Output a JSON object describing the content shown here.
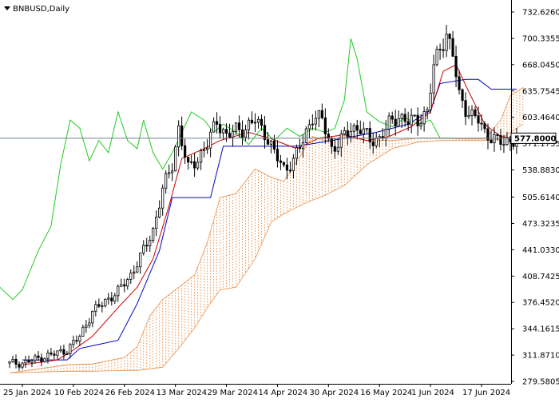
{
  "chart_data": {
    "type": "candlestick-ichimoku",
    "title": "BNBUSD,Daily",
    "current_price": {
      "label": "577.8000",
      "value": 577.8
    },
    "y_ticks": [
      {
        "label": "732.6260",
        "value": 732.626
      },
      {
        "label": "700.3355",
        "value": 700.3355
      },
      {
        "label": "668.0450",
        "value": 668.045
      },
      {
        "label": "635.7545",
        "value": 635.7545
      },
      {
        "label": "603.4640",
        "value": 603.464
      },
      {
        "label": "571.1735",
        "value": 571.1735
      },
      {
        "label": "538.8830",
        "value": 538.883
      },
      {
        "label": "505.6140",
        "value": 505.614
      },
      {
        "label": "473.3235",
        "value": 473.3235
      },
      {
        "label": "441.0330",
        "value": 441.033
      },
      {
        "label": "408.7425",
        "value": 408.7425
      },
      {
        "label": "376.4520",
        "value": 376.452
      },
      {
        "label": "344.1615",
        "value": 344.1615
      },
      {
        "label": "311.8710",
        "value": 311.871
      },
      {
        "label": "279.5805",
        "value": 279.5805
      }
    ],
    "x_ticks": [
      {
        "label": "25 Jan 2024",
        "date": "2024-01-25"
      },
      {
        "label": "10 Feb 2024",
        "date": "2024-02-10"
      },
      {
        "label": "26 Feb 2024",
        "date": "2024-02-26"
      },
      {
        "label": "13 Mar 2024",
        "date": "2024-03-13"
      },
      {
        "label": "29 Mar 2024",
        "date": "2024-03-29"
      },
      {
        "label": "14 Apr 2024",
        "date": "2024-04-14"
      },
      {
        "label": "30 Apr 2024",
        "date": "2024-04-30"
      },
      {
        "label": "16 May 2024",
        "date": "2024-05-16"
      },
      {
        "label": "1 Jun 2024",
        "date": "2024-06-01"
      },
      {
        "label": "17 Jun 2024",
        "date": "2024-06-17"
      }
    ],
    "ylim": [
      279.5805,
      745
    ],
    "colors": {
      "candle": "#000000",
      "tenkan": "#cc0000",
      "kijun": "#0000cc",
      "chikou": "#22cc22",
      "cloud": "#e8904a",
      "price_line": "#708090",
      "price_box": "#ffffff"
    },
    "series": [
      {
        "key": "close",
        "points": [
          [
            "2024-01-25",
            302
          ],
          [
            "2024-02-01",
            310
          ],
          [
            "2024-02-08",
            318
          ],
          [
            "2024-02-12",
            335
          ],
          [
            "2024-02-16",
            365
          ],
          [
            "2024-02-20",
            378
          ],
          [
            "2024-02-24",
            390
          ],
          [
            "2024-02-28",
            410
          ],
          [
            "2024-03-03",
            440
          ],
          [
            "2024-03-06",
            465
          ],
          [
            "2024-03-09",
            515
          ],
          [
            "2024-03-12",
            545
          ],
          [
            "2024-03-14",
            590
          ],
          [
            "2024-03-17",
            540
          ],
          [
            "2024-03-20",
            553
          ],
          [
            "2024-03-23",
            570
          ],
          [
            "2024-03-26",
            600
          ],
          [
            "2024-03-29",
            580
          ],
          [
            "2024-04-01",
            588
          ],
          [
            "2024-04-04",
            590
          ],
          [
            "2024-04-07",
            600
          ],
          [
            "2024-04-10",
            585
          ],
          [
            "2024-04-13",
            560
          ],
          [
            "2024-04-16",
            540
          ],
          [
            "2024-04-19",
            550
          ],
          [
            "2024-04-22",
            575
          ],
          [
            "2024-04-25",
            605
          ],
          [
            "2024-04-28",
            600
          ],
          [
            "2024-05-01",
            565
          ],
          [
            "2024-05-04",
            575
          ],
          [
            "2024-05-07",
            590
          ],
          [
            "2024-05-10",
            590
          ],
          [
            "2024-05-13",
            575
          ],
          [
            "2024-05-16",
            578
          ],
          [
            "2024-05-19",
            595
          ],
          [
            "2024-05-22",
            605
          ],
          [
            "2024-05-25",
            598
          ],
          [
            "2024-05-28",
            600
          ],
          [
            "2024-05-31",
            610
          ],
          [
            "2024-06-02",
            665
          ],
          [
            "2024-06-04",
            690
          ],
          [
            "2024-06-06",
            705
          ],
          [
            "2024-06-08",
            680
          ],
          [
            "2024-06-10",
            630
          ],
          [
            "2024-06-12",
            615
          ],
          [
            "2024-06-14",
            605
          ],
          [
            "2024-06-16",
            600
          ],
          [
            "2024-06-18",
            585
          ],
          [
            "2024-06-20",
            580
          ],
          [
            "2024-06-22",
            574
          ],
          [
            "2024-06-24",
            572
          ],
          [
            "2024-06-26",
            576
          ],
          [
            "2024-06-28",
            578
          ]
        ]
      },
      {
        "key": "tenkan",
        "points": [
          [
            "2024-01-25",
            300
          ],
          [
            "2024-02-05",
            306
          ],
          [
            "2024-02-10",
            318
          ],
          [
            "2024-02-16",
            335
          ],
          [
            "2024-02-24",
            370
          ],
          [
            "2024-03-01",
            395
          ],
          [
            "2024-03-06",
            430
          ],
          [
            "2024-03-11",
            495
          ],
          [
            "2024-03-15",
            553
          ],
          [
            "2024-03-22",
            565
          ],
          [
            "2024-03-27",
            575
          ],
          [
            "2024-04-05",
            585
          ],
          [
            "2024-04-12",
            577
          ],
          [
            "2024-04-20",
            565
          ],
          [
            "2024-04-27",
            578
          ],
          [
            "2024-05-05",
            582
          ],
          [
            "2024-05-12",
            575
          ],
          [
            "2024-05-19",
            580
          ],
          [
            "2024-05-26",
            592
          ],
          [
            "2024-06-01",
            610
          ],
          [
            "2024-06-05",
            660
          ],
          [
            "2024-06-09",
            668
          ],
          [
            "2024-06-13",
            635
          ],
          [
            "2024-06-18",
            595
          ],
          [
            "2024-06-23",
            580
          ],
          [
            "2024-06-28",
            577
          ]
        ]
      },
      {
        "key": "kijun",
        "points": [
          [
            "2024-01-25",
            306
          ],
          [
            "2024-02-08",
            306
          ],
          [
            "2024-02-12",
            320
          ],
          [
            "2024-02-24",
            330
          ],
          [
            "2024-03-01",
            375
          ],
          [
            "2024-03-08",
            440
          ],
          [
            "2024-03-12",
            505
          ],
          [
            "2024-03-20",
            505
          ],
          [
            "2024-03-24",
            505
          ],
          [
            "2024-03-28",
            568
          ],
          [
            "2024-04-20",
            568
          ],
          [
            "2024-05-01",
            575
          ],
          [
            "2024-05-15",
            585
          ],
          [
            "2024-05-25",
            595
          ],
          [
            "2024-06-01",
            612
          ],
          [
            "2024-06-04",
            645
          ],
          [
            "2024-06-12",
            650
          ],
          [
            "2024-06-16",
            650
          ],
          [
            "2024-06-20",
            638
          ],
          [
            "2024-06-28",
            638
          ]
        ]
      },
      {
        "key": "chikou",
        "points": [
          [
            "2024-01-18",
            395
          ],
          [
            "2024-01-22",
            380
          ],
          [
            "2024-01-25",
            392
          ],
          [
            "2024-01-30",
            440
          ],
          [
            "2024-02-03",
            470
          ],
          [
            "2024-02-06",
            545
          ],
          [
            "2024-02-09",
            600
          ],
          [
            "2024-02-12",
            590
          ],
          [
            "2024-02-15",
            550
          ],
          [
            "2024-02-18",
            575
          ],
          [
            "2024-02-21",
            560
          ],
          [
            "2024-02-24",
            610
          ],
          [
            "2024-02-27",
            575
          ],
          [
            "2024-03-01",
            565
          ],
          [
            "2024-03-03",
            600
          ],
          [
            "2024-03-06",
            560
          ],
          [
            "2024-03-09",
            540
          ],
          [
            "2024-03-12",
            560
          ],
          [
            "2024-03-15",
            585
          ],
          [
            "2024-03-18",
            610
          ],
          [
            "2024-03-22",
            600
          ],
          [
            "2024-03-25",
            585
          ],
          [
            "2024-03-28",
            595
          ],
          [
            "2024-04-01",
            585
          ],
          [
            "2024-04-05",
            570
          ],
          [
            "2024-04-09",
            590
          ],
          [
            "2024-04-13",
            575
          ],
          [
            "2024-04-17",
            590
          ],
          [
            "2024-04-21",
            580
          ],
          [
            "2024-04-25",
            590
          ],
          [
            "2024-04-29",
            585
          ],
          [
            "2024-05-02",
            590
          ],
          [
            "2024-05-05",
            625
          ],
          [
            "2024-05-07",
            700
          ],
          [
            "2024-05-09",
            675
          ],
          [
            "2024-05-12",
            610
          ],
          [
            "2024-05-16",
            598
          ],
          [
            "2024-05-20",
            592
          ],
          [
            "2024-05-24",
            603
          ],
          [
            "2024-05-28",
            595
          ],
          [
            "2024-06-01",
            600
          ],
          [
            "2024-06-04",
            578
          ],
          [
            "2024-06-08",
            578
          ]
        ]
      },
      {
        "key": "cloud_upper",
        "points": [
          [
            "2024-01-21",
            290
          ],
          [
            "2024-02-08",
            300
          ],
          [
            "2024-02-16",
            301
          ],
          [
            "2024-02-26",
            309
          ],
          [
            "2024-03-01",
            322
          ],
          [
            "2024-03-05",
            360
          ],
          [
            "2024-03-09",
            380
          ],
          [
            "2024-03-14",
            395
          ],
          [
            "2024-03-19",
            410
          ],
          [
            "2024-03-23",
            450
          ],
          [
            "2024-03-27",
            505
          ],
          [
            "2024-04-01",
            510
          ],
          [
            "2024-04-07",
            540
          ],
          [
            "2024-04-12",
            530
          ],
          [
            "2024-04-16",
            525
          ],
          [
            "2024-04-21",
            555
          ],
          [
            "2024-04-25",
            580
          ],
          [
            "2024-04-29",
            575
          ],
          [
            "2024-05-05",
            580
          ],
          [
            "2024-05-12",
            575
          ],
          [
            "2024-05-20",
            575
          ],
          [
            "2024-05-28",
            578
          ],
          [
            "2024-06-04",
            578
          ],
          [
            "2024-06-12",
            577
          ],
          [
            "2024-06-18",
            577
          ],
          [
            "2024-06-23",
            600
          ],
          [
            "2024-06-26",
            630
          ],
          [
            "2024-06-30",
            640
          ]
        ]
      },
      {
        "key": "cloud_lower",
        "points": [
          [
            "2024-01-21",
            290
          ],
          [
            "2024-02-08",
            292
          ],
          [
            "2024-02-16",
            292
          ],
          [
            "2024-02-26",
            293
          ],
          [
            "2024-03-01",
            293
          ],
          [
            "2024-03-05",
            295
          ],
          [
            "2024-03-09",
            297
          ],
          [
            "2024-03-14",
            320
          ],
          [
            "2024-03-19",
            345
          ],
          [
            "2024-03-23",
            370
          ],
          [
            "2024-03-27",
            392
          ],
          [
            "2024-04-01",
            395
          ],
          [
            "2024-04-07",
            430
          ],
          [
            "2024-04-12",
            475
          ],
          [
            "2024-04-16",
            485
          ],
          [
            "2024-04-21",
            495
          ],
          [
            "2024-04-25",
            502
          ],
          [
            "2024-04-29",
            508
          ],
          [
            "2024-05-05",
            520
          ],
          [
            "2024-05-12",
            545
          ],
          [
            "2024-05-20",
            565
          ],
          [
            "2024-05-28",
            573
          ],
          [
            "2024-06-04",
            575
          ],
          [
            "2024-06-12",
            575
          ],
          [
            "2024-06-18",
            575
          ],
          [
            "2024-06-23",
            577
          ],
          [
            "2024-06-26",
            585
          ],
          [
            "2024-06-30",
            595
          ]
        ]
      }
    ]
  }
}
